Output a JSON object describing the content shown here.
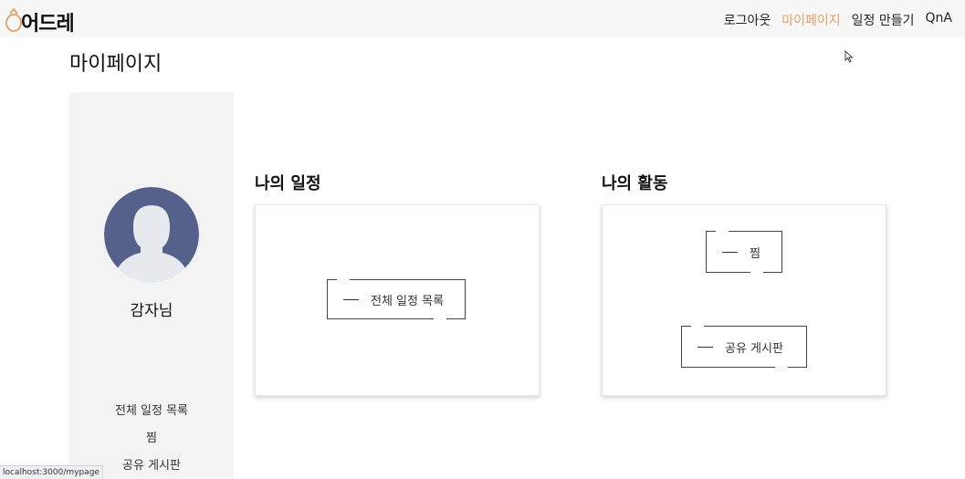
{
  "header": {
    "logo_text": "어드레",
    "nav": [
      {
        "label": "로그아웃"
      },
      {
        "label": "마이페이지",
        "active": true
      },
      {
        "label": "일정 만들기"
      },
      {
        "label": "QnA"
      }
    ],
    "active_color": "#e0a06a"
  },
  "page": {
    "title": "마이페이지"
  },
  "sidebar": {
    "username": "감자님",
    "links": [
      "전체 일정 목록",
      "찜",
      "공유 게시판"
    ]
  },
  "sections": {
    "schedule": {
      "title": "나의 일정",
      "buttons": [
        "전체 일정 목록"
      ]
    },
    "activity": {
      "title": "나의 활동",
      "buttons": [
        "찜",
        "공유 게시판"
      ]
    }
  },
  "status_bar": {
    "url": "localhost:3000/mypage"
  }
}
